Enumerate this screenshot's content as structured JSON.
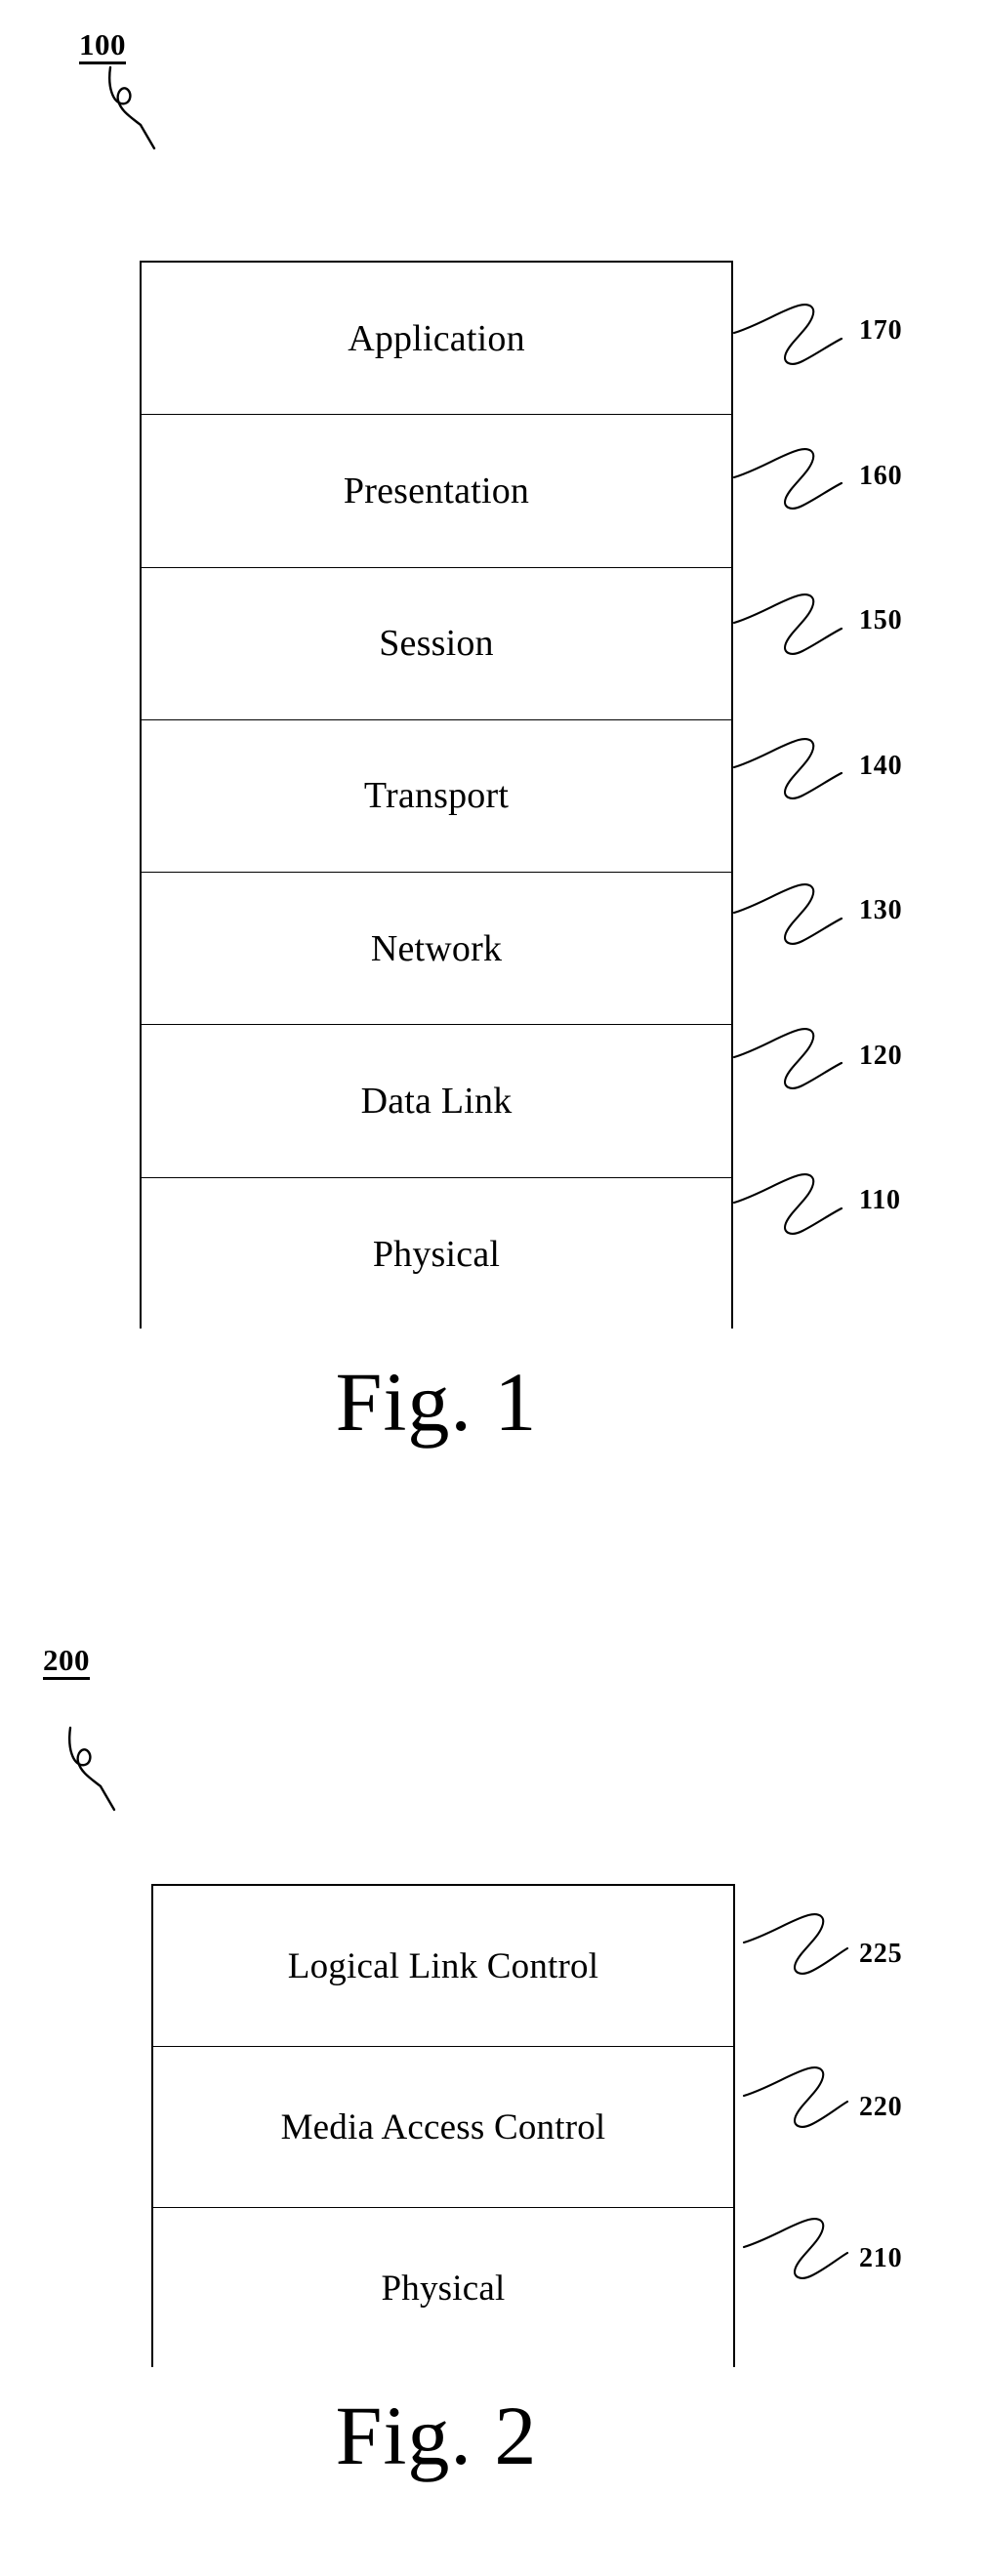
{
  "document": {
    "kind": "patent-drawing-sheet",
    "background_color": "#ffffff",
    "ink_color": "#000000"
  },
  "figures": [
    {
      "id": "fig1",
      "group_reference": "100",
      "caption": "Fig. 1",
      "layers": [
        {
          "label": "Application",
          "reference": "170"
        },
        {
          "label": "Presentation",
          "reference": "160"
        },
        {
          "label": "Session",
          "reference": "150"
        },
        {
          "label": "Transport",
          "reference": "140"
        },
        {
          "label": "Network",
          "reference": "130"
        },
        {
          "label": "Data Link",
          "reference": "120"
        },
        {
          "label": "Physical",
          "reference": "110"
        }
      ]
    },
    {
      "id": "fig2",
      "group_reference": "200",
      "caption": "Fig. 2",
      "layers": [
        {
          "label": "Logical Link Control",
          "reference": "225"
        },
        {
          "label": "Media Access Control",
          "reference": "220"
        },
        {
          "label": "Physical",
          "reference": "210"
        }
      ]
    }
  ]
}
